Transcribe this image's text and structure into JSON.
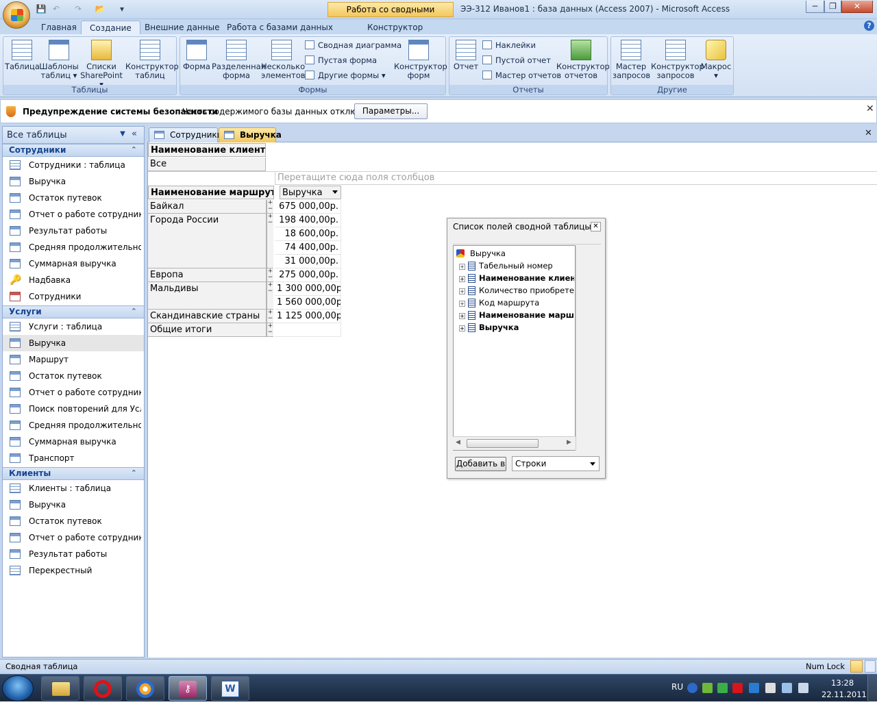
{
  "window": {
    "context_tab_title": "Работа со сводными таблицами",
    "title": "ЭЭ-312 Иванов1 : база данных (Access 2007)  -  Microsoft Access",
    "close_glyph": "✕",
    "minimize_glyph": "─",
    "restore_glyph": "❐"
  },
  "ribbon_tabs": [
    "Главная",
    "Создание",
    "Внешние данные",
    "Работа с базами данных",
    "Конструктор"
  ],
  "help_glyph": "?",
  "ribbon": {
    "tables": {
      "label": "Таблицы",
      "table": "Таблица",
      "templates_1": "Шаблоны",
      "templates_2": "таблиц ▾",
      "sharepoint_1": "Списки",
      "sharepoint_2": "SharePoint ▾",
      "designer_1": "Конструктор",
      "designer_2": "таблиц"
    },
    "forms": {
      "label": "Формы",
      "form": "Форма",
      "split_1": "Разделенная",
      "split_2": "форма",
      "multi_1": "Несколько",
      "multi_2": "элементов",
      "pivot_chart": "Сводная диаграмма",
      "blank_form": "Пустая форма",
      "other_forms": "Другие формы ▾",
      "designer_1": "Конструктор",
      "designer_2": "форм"
    },
    "reports": {
      "label": "Отчеты",
      "report": "Отчет",
      "labels": "Наклейки",
      "blank_report": "Пустой отчет",
      "wizard": "Мастер отчетов",
      "designer_1": "Конструктор",
      "designer_2": "отчетов"
    },
    "other": {
      "label": "Другие",
      "query_wizard_1": "Мастер",
      "query_wizard_2": "запросов",
      "query_designer_1": "Конструктор",
      "query_designer_2": "запросов",
      "macro_1": "Макрос",
      "macro_2": "▾"
    }
  },
  "security": {
    "title": "Предупреждение системы безопасности",
    "text": "Часть содержимого базы данных отключено",
    "button": "Параметры...",
    "close": "✕"
  },
  "nav": {
    "title": "Все таблицы",
    "groups": [
      {
        "name": "Сотрудники",
        "items": [
          "Сотрудники : таблица",
          "Выручка",
          "Остаток путевок",
          "Отчет о работе сотрудника",
          "Результат работы",
          "Средняя продолжительност...",
          "Суммарная выручка",
          "Надбавка",
          "Сотрудники"
        ]
      },
      {
        "name": "Услуги",
        "items": [
          "Услуги : таблица",
          "Выручка",
          "Маршрут",
          "Остаток путевок",
          "Отчет о работе сотрудника",
          "Поиск повторений для Услуги",
          "Средняя продолжительност...",
          "Суммарная выручка",
          "Транспорт"
        ]
      },
      {
        "name": "Клиенты",
        "items": [
          "Клиенты : таблица",
          "Выручка",
          "Остаток путевок",
          "Отчет о работе сотрудника",
          "Результат работы",
          "Перекрестный"
        ]
      }
    ]
  },
  "doc_tabs": [
    "Сотрудники",
    "Выручка"
  ],
  "pivot": {
    "filter_field": "Наименование клиента",
    "filter_value": "Все",
    "column_drop_hint": "Перетащите сюда поля столбцов",
    "row_field": "Наименование маршрута",
    "data_field": "Выручка",
    "rows": [
      {
        "label": "Байкал",
        "values": [
          "675 000,00р."
        ]
      },
      {
        "label": "Города России",
        "values": [
          "198 400,00р.",
          "18 600,00р.",
          "74 400,00р.",
          "31 000,00р."
        ]
      },
      {
        "label": "Европа",
        "values": [
          "275 000,00р."
        ]
      },
      {
        "label": "Мальдивы",
        "values": [
          "1 300 000,00р.",
          "1 560 000,00р."
        ]
      },
      {
        "label": "Скандинавские страны",
        "values": [
          "1 125 000,00р."
        ]
      },
      {
        "label": "Общие итоги",
        "values": [
          ""
        ]
      }
    ]
  },
  "field_list": {
    "title": "Список полей сводной таблицы",
    "root": "Выручка",
    "fields": [
      "Табельный номер",
      "Наименование клиента",
      "Количество приобретенн",
      "Код маршрута",
      "Наименование маршру",
      "Выручка"
    ],
    "bold_fields": [
      false,
      true,
      false,
      false,
      true,
      true
    ],
    "add_button": "Добавить в",
    "target": "Строки"
  },
  "status": {
    "left": "Сводная таблица",
    "right": "Num Lock"
  },
  "taskbar": {
    "lang": "RU",
    "time": "13:28",
    "date": "22.11.2011"
  }
}
